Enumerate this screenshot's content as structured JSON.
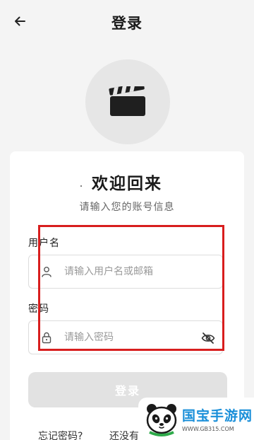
{
  "header": {
    "title": "登录"
  },
  "login": {
    "welcome": "欢迎回来",
    "subtitle": "请输入您的账号信息",
    "username": {
      "label": "用户名",
      "placeholder": "请输入用户名或邮箱",
      "value": ""
    },
    "password": {
      "label": "密码",
      "placeholder": "请输入密码",
      "value": ""
    },
    "submit_label": "登录",
    "forgot_label": "忘记密码?",
    "register_label": "还没有"
  },
  "watermark": {
    "name": "国宝手游网",
    "url": "WWW.GB315.COM"
  },
  "icons": {
    "back": "arrow-left-icon",
    "logo": "clapperboard-icon",
    "user": "user-icon",
    "lock": "lock-icon",
    "eye": "eye-off-icon"
  },
  "colors": {
    "background": "#f4f4f4",
    "card": "#ffffff",
    "highlight": "#d81e1e",
    "button_disabled": "#e2e2e2",
    "watermark_blue": "#1a8fd9"
  }
}
